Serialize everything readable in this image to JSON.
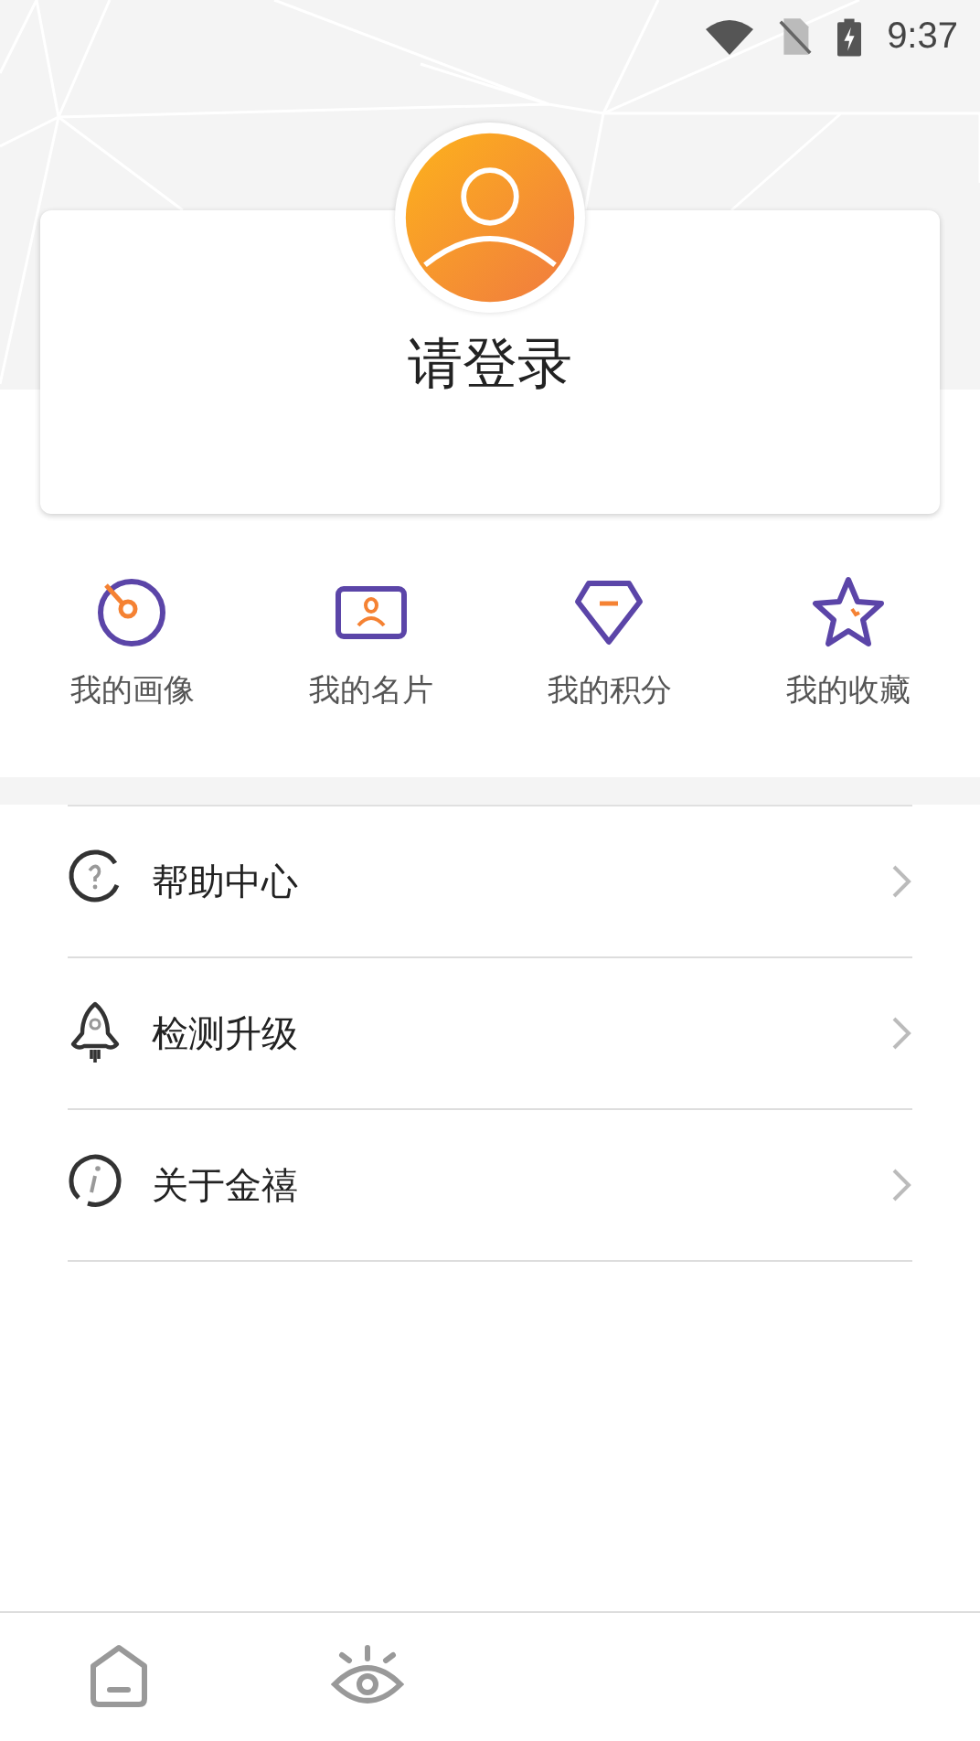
{
  "status_bar": {
    "time": "9:37"
  },
  "profile": {
    "login_prompt": "请登录"
  },
  "shortcuts": [
    {
      "label": "我的画像",
      "kind": "gauge"
    },
    {
      "label": "我的名片",
      "kind": "card"
    },
    {
      "label": "我的积分",
      "kind": "diamond"
    },
    {
      "label": "我的收藏",
      "kind": "star"
    }
  ],
  "menu": [
    {
      "label": "帮助中心",
      "kind": "help"
    },
    {
      "label": "检测升级",
      "kind": "rocket"
    },
    {
      "label": "关于金禧",
      "kind": "info"
    }
  ],
  "tab_bar": [
    {
      "kind": "home",
      "selected": false
    },
    {
      "kind": "eye",
      "selected": false
    }
  ]
}
